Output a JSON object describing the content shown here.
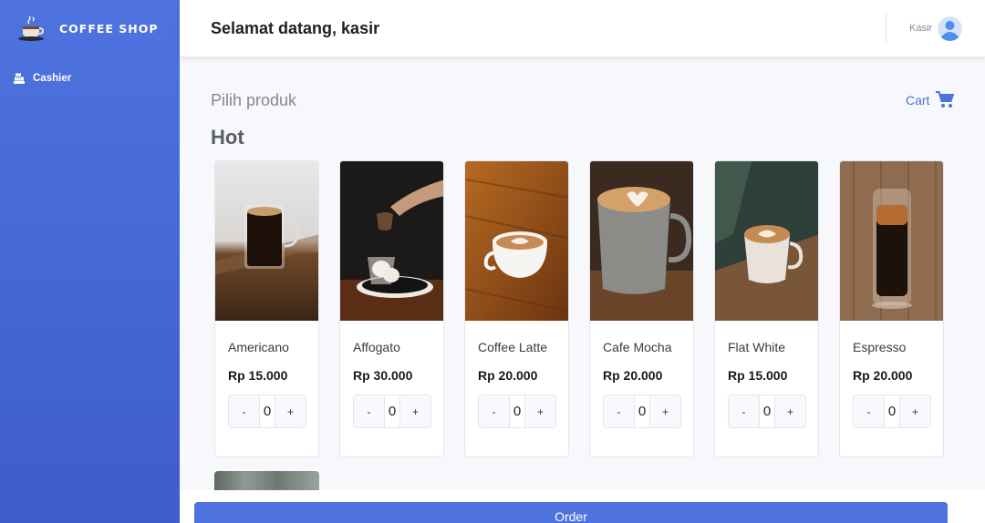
{
  "brand": {
    "name": "COFFEE SHOP"
  },
  "sidebar": {
    "items": [
      {
        "label": "Cashier",
        "icon": "cash-register-icon"
      }
    ]
  },
  "header": {
    "welcome": "Selamat datang, kasir",
    "user": "Kasir"
  },
  "main": {
    "title": "Pilih produk",
    "cart_label": "Cart",
    "category": "Hot",
    "products": [
      {
        "name": "Americano",
        "price": "Rp 15.000",
        "qty": "0",
        "minus": "-",
        "plus": "+"
      },
      {
        "name": "Affogato",
        "price": "Rp 30.000",
        "qty": "0",
        "minus": "-",
        "plus": "+"
      },
      {
        "name": "Coffee Latte",
        "price": "Rp 20.000",
        "qty": "0",
        "minus": "-",
        "plus": "+"
      },
      {
        "name": "Cafe Mocha",
        "price": "Rp 20.000",
        "qty": "0",
        "minus": "-",
        "plus": "+"
      },
      {
        "name": "Flat White",
        "price": "Rp 15.000",
        "qty": "0",
        "minus": "-",
        "plus": "+"
      },
      {
        "name": "Espresso",
        "price": "Rp 20.000",
        "qty": "0",
        "minus": "-",
        "plus": "+"
      }
    ]
  },
  "footer": {
    "order_label": "Order"
  },
  "colors": {
    "primary": "#4e73df",
    "background": "#f7f8fc"
  }
}
